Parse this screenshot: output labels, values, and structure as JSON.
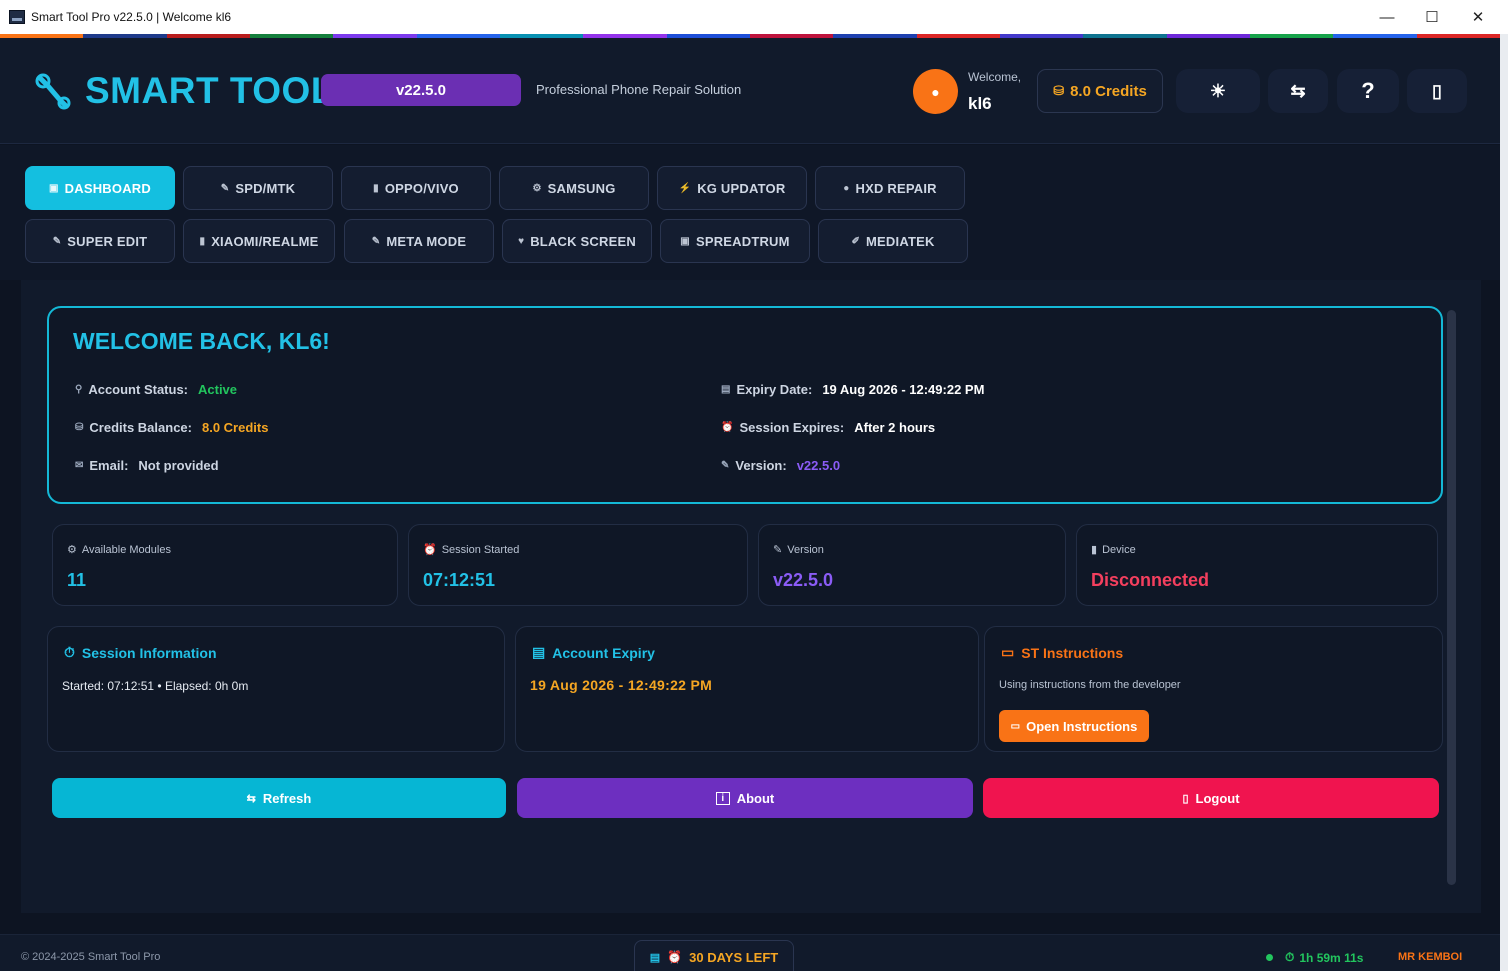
{
  "window": {
    "title": "Smart Tool Pro v22.5.0 | Welcome kl6",
    "min": "—",
    "max": "☐",
    "close": "✕"
  },
  "rainbow_colors": [
    "#f97316",
    "#1e3a8a",
    "#b91c1c",
    "#15803d",
    "#7c3aed",
    "#2563eb",
    "#0891b2",
    "#9333ea",
    "#1d4ed8",
    "#be123c",
    "#1e40af",
    "#dc2626",
    "#4338ca",
    "#0e7490",
    "#6d28d9",
    "#16a34a",
    "#2563eb",
    "#dc2626"
  ],
  "header": {
    "brand": "SMART TOOL",
    "version_pill": "v22.5.0",
    "tagline": "Professional Phone Repair Solution",
    "welcome_label": "Welcome,",
    "username": "kl6",
    "credits": "8.0 Credits",
    "theme_icon": "☀",
    "switch_icon": "⇆",
    "help_icon": "?",
    "device_icon": "▯"
  },
  "nav": {
    "row1": [
      {
        "label": "DASHBOARD",
        "icon": "▣"
      },
      {
        "label": "SPD/MTK",
        "icon": "✎"
      },
      {
        "label": "OPPO/VIVO",
        "icon": "▮"
      },
      {
        "label": "SAMSUNG",
        "icon": "⚙"
      },
      {
        "label": "KG UPDATOR",
        "icon": "⚡"
      },
      {
        "label": "HXD REPAIR",
        "icon": "●"
      }
    ],
    "row2": [
      {
        "label": "SUPER EDIT",
        "icon": "✎"
      },
      {
        "label": "XIAOMI/REALME",
        "icon": "▮"
      },
      {
        "label": "META MODE",
        "icon": "✎"
      },
      {
        "label": "BLACK SCREEN",
        "icon": "♥"
      },
      {
        "label": "SPREADTRUM",
        "icon": "▣"
      },
      {
        "label": "MEDIATEK",
        "icon": "✐"
      }
    ]
  },
  "welcome": {
    "title": "WELCOME BACK, KL6!",
    "account_status_label": "Account Status:",
    "account_status": "Active",
    "credits_label": "Credits Balance:",
    "credits": "8.0 Credits",
    "email_label": "Email:",
    "email": "Not provided",
    "expiry_label": "Expiry Date:",
    "expiry": "19 Aug 2026 - 12:49:22 PM",
    "session_label": "Session Expires:",
    "session": "After 2 hours",
    "version_label": "Version:",
    "version": "v22.5.0"
  },
  "stats": [
    {
      "label": "Available Modules",
      "value": "11",
      "icon": "⚙"
    },
    {
      "label": "Session Started",
      "value": "07:12:51",
      "icon": "⏰"
    },
    {
      "label": "Version",
      "value": "v22.5.0",
      "icon": "✎"
    },
    {
      "label": "Device",
      "value": "Disconnected",
      "icon": "▮"
    }
  ],
  "session_panel": {
    "title": "Session Information",
    "text": "Started: 07:12:51 • Elapsed: 0h 0m"
  },
  "expiry_panel": {
    "title": "Account Expiry",
    "value": "19 Aug 2026 - 12:49:22 PM"
  },
  "instructions_panel": {
    "title": "ST Instructions",
    "text": "Using instructions from the developer",
    "button": "Open Instructions"
  },
  "actions": {
    "refresh": "Refresh",
    "about": "About",
    "logout": "Logout"
  },
  "footer": {
    "copyright": "© 2024-2025 Smart Tool Pro",
    "days_left": "30 DAYS LEFT",
    "timer": "1h 59m 11s",
    "credit_tag": "MR KEMBOI"
  }
}
